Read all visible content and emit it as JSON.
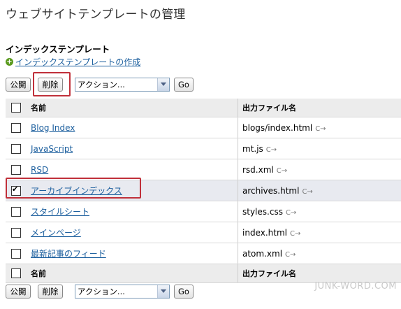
{
  "page": {
    "title": "ウェブサイトテンプレートの管理"
  },
  "section": {
    "title": "インデックステンプレート",
    "create_link": "インデックステンプレートの作成"
  },
  "actions": {
    "publish": "公開",
    "delete": "削除",
    "select_value": "アクション...",
    "go": "Go"
  },
  "table": {
    "header_name": "名前",
    "header_output": "出力ファイル名",
    "rows": [
      {
        "name": "Blog Index",
        "output": "blogs/index.html",
        "checked": false
      },
      {
        "name": "JavaScript",
        "output": "mt.js",
        "checked": false
      },
      {
        "name": "RSD",
        "output": "rsd.xml",
        "checked": false
      },
      {
        "name": "アーカイブインデックス",
        "output": "archives.html",
        "checked": true
      },
      {
        "name": "スタイルシート",
        "output": "styles.css",
        "checked": false
      },
      {
        "name": "メインページ",
        "output": "index.html",
        "checked": false
      },
      {
        "name": "最新記事のフィード",
        "output": "atom.xml",
        "checked": false
      }
    ]
  },
  "watermark": "JUNK-WORD.COM",
  "colors": {
    "link": "#1c5f9e",
    "highlight": "#c0303a",
    "plus": "#5a9a1e"
  }
}
